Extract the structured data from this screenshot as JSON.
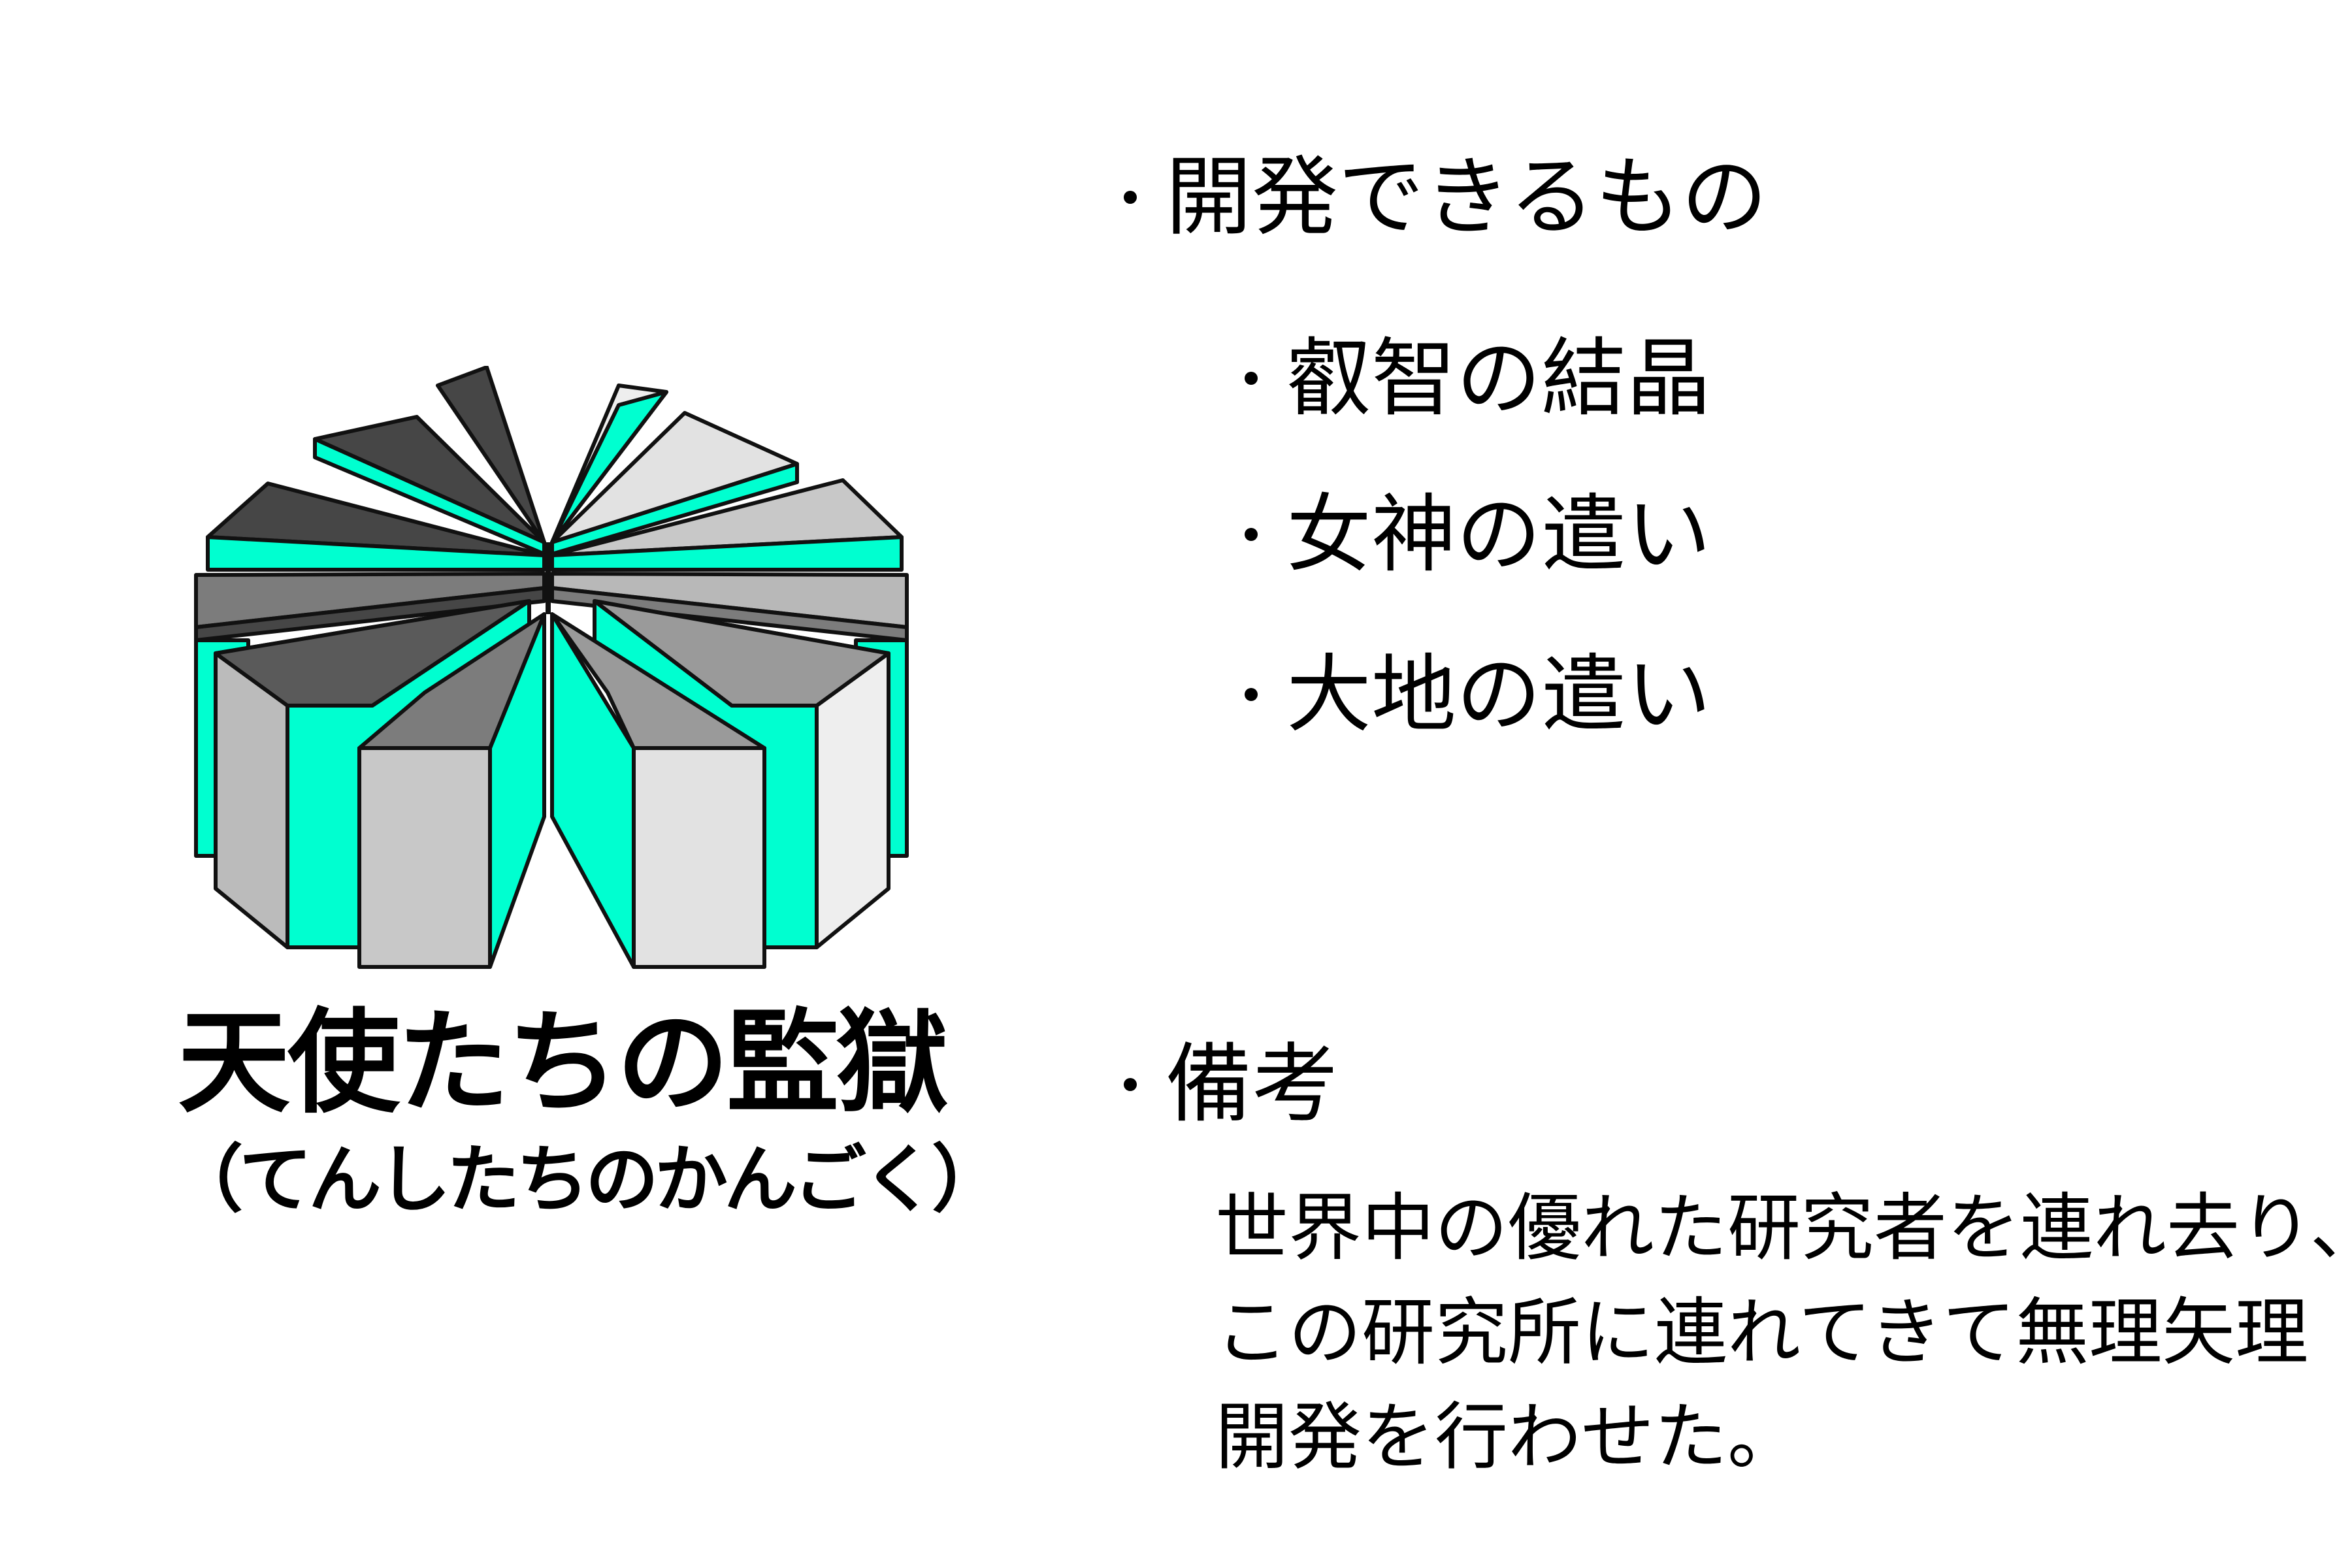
{
  "logo": {
    "icon": "angel-prison-logo-icon",
    "title": "天使たちの監獄",
    "reading": "（てんしたちのかんごく）",
    "colors": {
      "accent": "#00FFD0",
      "dark": "#464646",
      "mid": "#7C7C7C",
      "light": "#C8C8C8",
      "lighter": "#E2E2E2",
      "outline": "#111111"
    }
  },
  "developable": {
    "heading": "開発できるもの",
    "items": [
      "叡智の結晶",
      "女神の遣い",
      "大地の遣い"
    ]
  },
  "remarks": {
    "heading": "備考",
    "lines": [
      "世界中の優れた研究者を連れ去り、",
      "この研究所に連れてきて無理矢理",
      "開発を行わせた。"
    ]
  }
}
